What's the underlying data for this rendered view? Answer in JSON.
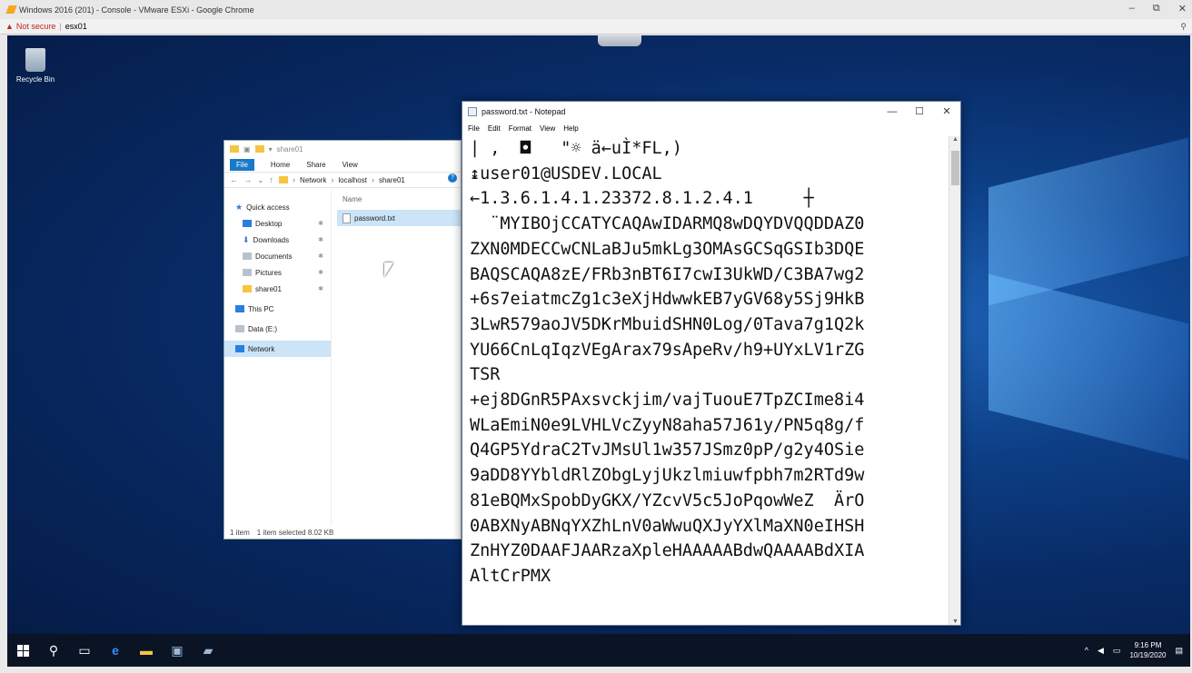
{
  "browser": {
    "tab_title": "Windows 2016 (201) - Console - VMware ESXi - Google Chrome",
    "security_label": "Not secure",
    "host": "esx01",
    "controls": [
      "–",
      "⧉",
      "✕"
    ],
    "zoom_icon": "⚲"
  },
  "desktop": {
    "recycle_label": "Recycle Bin"
  },
  "explorer": {
    "window_title": "share01",
    "ribbon_tabs": [
      "File",
      "Home",
      "Share",
      "View"
    ],
    "breadcrumb": [
      "Network",
      "localhost",
      "share01"
    ],
    "column_name": "Name",
    "sidebar": [
      {
        "label": "Quick access",
        "icon": "star-icon",
        "sub": false
      },
      {
        "label": "Desktop",
        "icon": "desktop-icon",
        "sub": true
      },
      {
        "label": "Downloads",
        "icon": "download-icon",
        "sub": true
      },
      {
        "label": "Documents",
        "icon": "documents-icon",
        "sub": true
      },
      {
        "label": "Pictures",
        "icon": "pictures-icon",
        "sub": true
      },
      {
        "label": "share01",
        "icon": "folder-icon",
        "sub": true
      },
      {
        "label": "This PC",
        "icon": "pc-icon",
        "sub": false
      },
      {
        "label": "Data (E:)",
        "icon": "drive-icon",
        "sub": false
      },
      {
        "label": "Network",
        "icon": "network-icon",
        "sub": false
      }
    ],
    "file": "password.txt",
    "status_count": "1 item",
    "status_selected": "1 item selected  8.02 KB"
  },
  "notepad": {
    "title": "password.txt - Notepad",
    "menu": [
      "File",
      "Edit",
      "Format",
      "View",
      "Help"
    ],
    "controls": [
      "—",
      "☐",
      "✕"
    ],
    "lines": [
      "| ,  ◘   \"☼ ä←uÌ*FL,)",
      "↨user01@USDEV.LOCAL",
      "←1.3.6.1.4.1.23372.8.1.2.4.1     ┼",
      "  ¨MYIBOjCCATYCAQAwIDARMQ8wDQYDVQQDDAZ0",
      "ZXN0MDECCwCNLaBJu5mkLg3OMAsGCSqGSIb3DQE",
      "BAQSCAQA8zE/FRb3nBT6I7cwI3UkWD/C3BA7wg2",
      "+6s7eiatmcZg1c3eXjHdwwkEB7yGV68y5Sj9HkB",
      "3LwR579aoJV5DKrMbuidSHN0Log/0Tava7g1Q2k",
      "YU66CnLqIqzVEgArax79sApeRv/h9+UYxLV1rZG",
      "TSR",
      "+ej8DGnR5PAxsvckjim/vajTuouE7TpZCIme8i4",
      "WLaEmiN0e9LVHLVcZyyN8aha57J61y/PN5q8g/f",
      "Q4GP5YdraC2TvJMsUl1w357JSmz0pP/g2y4OSie",
      "9aDD8YYbldRlZObgLyjUkzlmiuwfpbh7m2RTd9w",
      "81eBQMxSpobDyGKX/YZcvV5c5JoPqowWeZ  ÄrO",
      "0ABXNyABNqYXZhLnV0aWwuQXJyYXlMaXN0eIHSH",
      "ZnHYZ0DAAFJAARzaXpleHAAAAABdwQAAAABdXIA",
      "AltCrPMX"
    ]
  },
  "taskbar": {
    "icons": [
      "windows-start-icon",
      "search-icon",
      "task-view-icon",
      "edge-icon",
      "file-explorer-icon",
      "server-manager-icon",
      "notepad-icon"
    ],
    "tray_chevron": "^",
    "time": "9:16 PM",
    "date": "10/19/2020"
  }
}
